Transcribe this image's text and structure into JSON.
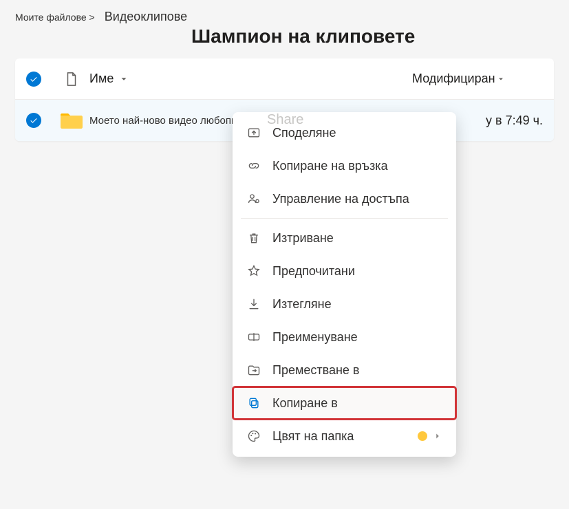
{
  "breadcrumb": {
    "crumb1": "Моите файлове >",
    "crumb2": "Видеоклипове"
  },
  "page_title": "Шампион на клиповете",
  "columns": {
    "name": "Име",
    "modified": "Модифициран"
  },
  "file": {
    "name": "Моето най-ново видео любопитно",
    "modified_fragment": "у в 7:49 ч."
  },
  "menu": {
    "share": "Споделяне",
    "ghost": "Share",
    "copy_link": "Копиране на връзка",
    "manage_access": "Управление на достъпа",
    "delete": "Изтриване",
    "favorite": "Предпочитани",
    "download": "Изтегляне",
    "rename": "Преименуване",
    "move_to": "Преместване в",
    "copy_to": "Копиране в",
    "folder_color": "Цвят на папка"
  }
}
